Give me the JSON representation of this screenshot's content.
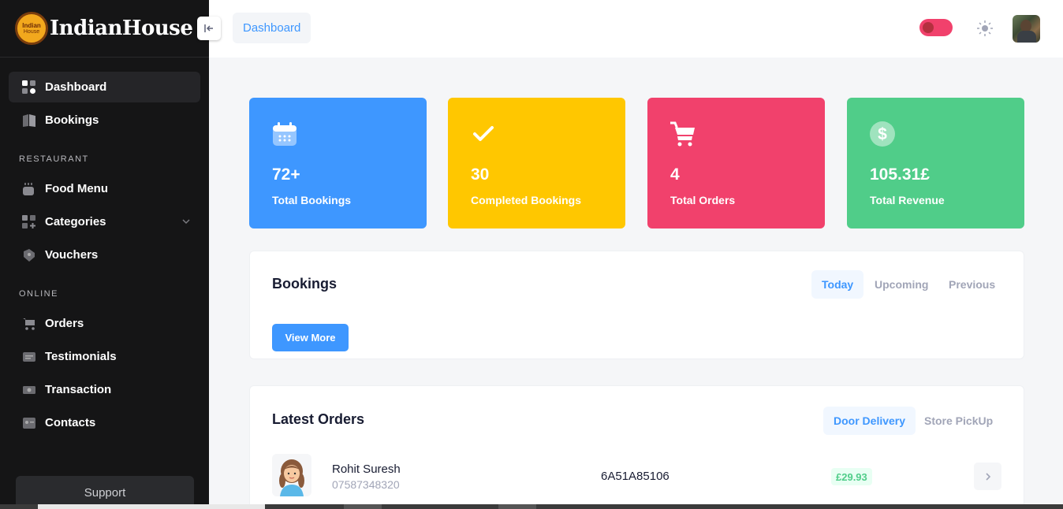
{
  "brand": {
    "name": "IndianHouse",
    "badge_top": "Indian",
    "badge_bottom": "House"
  },
  "sidebar": {
    "items_top": [
      {
        "label": "Dashboard",
        "icon": "dashboard-grid-icon",
        "active": true
      },
      {
        "label": "Bookings",
        "icon": "book-icon",
        "active": false
      }
    ],
    "section_restaurant": "RESTAURANT",
    "items_restaurant": [
      {
        "label": "Food Menu",
        "icon": "pot-icon"
      },
      {
        "label": "Categories",
        "icon": "category-grid-icon"
      },
      {
        "label": "Vouchers",
        "icon": "tag-icon"
      }
    ],
    "section_online": "ONLINE",
    "items_online": [
      {
        "label": "Orders",
        "icon": "cart-icon"
      },
      {
        "label": "Testimonials",
        "icon": "message-icon"
      },
      {
        "label": "Transaction",
        "icon": "money-icon"
      },
      {
        "label": "Contacts",
        "icon": "contact-card-icon"
      }
    ],
    "support_label": "Support"
  },
  "header": {
    "breadcrumb": "Dashboard",
    "dark_mode_toggle": "on"
  },
  "stats": [
    {
      "value": "72+",
      "label": "Total Bookings",
      "color": "#3e97ff",
      "icon": "calendar-icon"
    },
    {
      "value": "30",
      "label": "Completed Bookings",
      "color": "#ffc700",
      "icon": "check-icon"
    },
    {
      "value": "4",
      "label": "Total Orders",
      "color": "#f1416c",
      "icon": "cart-icon"
    },
    {
      "value": "105.31£",
      "label": "Total Revenue",
      "color": "#50cd89",
      "icon": "dollar-icon"
    }
  ],
  "bookings": {
    "title": "Bookings",
    "tabs": [
      "Today",
      "Upcoming",
      "Previous"
    ],
    "active_tab": "Today",
    "view_more": "View More"
  },
  "orders": {
    "title": "Latest Orders",
    "tabs": [
      "Door Delivery",
      "Store PickUp"
    ],
    "active_tab": "Door Delivery",
    "rows": [
      {
        "name": "Rohit Suresh",
        "phone": "07587348320",
        "order_id": "6A51A85106",
        "amount": "£29.93"
      }
    ]
  }
}
